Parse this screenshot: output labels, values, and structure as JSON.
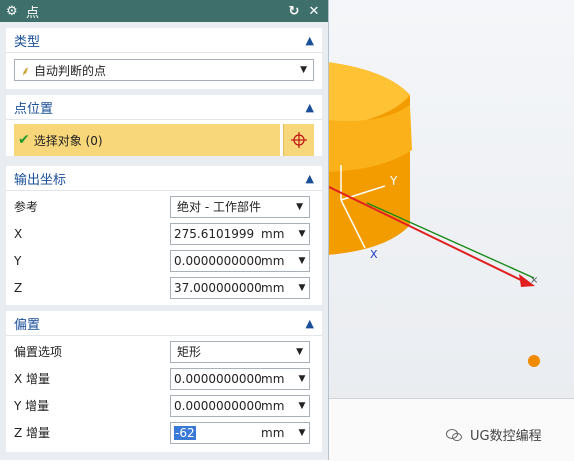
{
  "dialog": {
    "title": "点",
    "icons": {
      "settings": "gear-icon",
      "reset": "reset-icon",
      "close": "close-icon"
    }
  },
  "type_section": {
    "header": "类型",
    "value": "自动判断的点"
  },
  "point_location": {
    "header": "点位置",
    "select_label": "选择对象 (0)"
  },
  "output_coords": {
    "header": "输出坐标",
    "reference_label": "参考",
    "reference_value": "绝对 - 工作部件",
    "x_label": "X",
    "x_value": "275.6101999",
    "y_label": "Y",
    "y_value": "0.0000000000",
    "z_label": "Z",
    "z_value": "37.000000000",
    "unit": "mm"
  },
  "offset": {
    "header": "偏置",
    "option_label": "偏置选项",
    "option_value": "矩形",
    "dx_label": "X 增量",
    "dx_value": "0.0000000000",
    "dy_label": "Y 增量",
    "dy_value": "0.0000000000",
    "dz_label": "Z 增量",
    "dz_value": "-62",
    "unit": "mm"
  },
  "viewport": {
    "axis_y": "Y",
    "axis_x": "X"
  },
  "watermark": {
    "text": "UG数控编程"
  },
  "colors": {
    "titlebar": "#3f6f6b",
    "accent": "#1a4f99",
    "selection": "#f7d77a",
    "part": "#f5a300"
  }
}
